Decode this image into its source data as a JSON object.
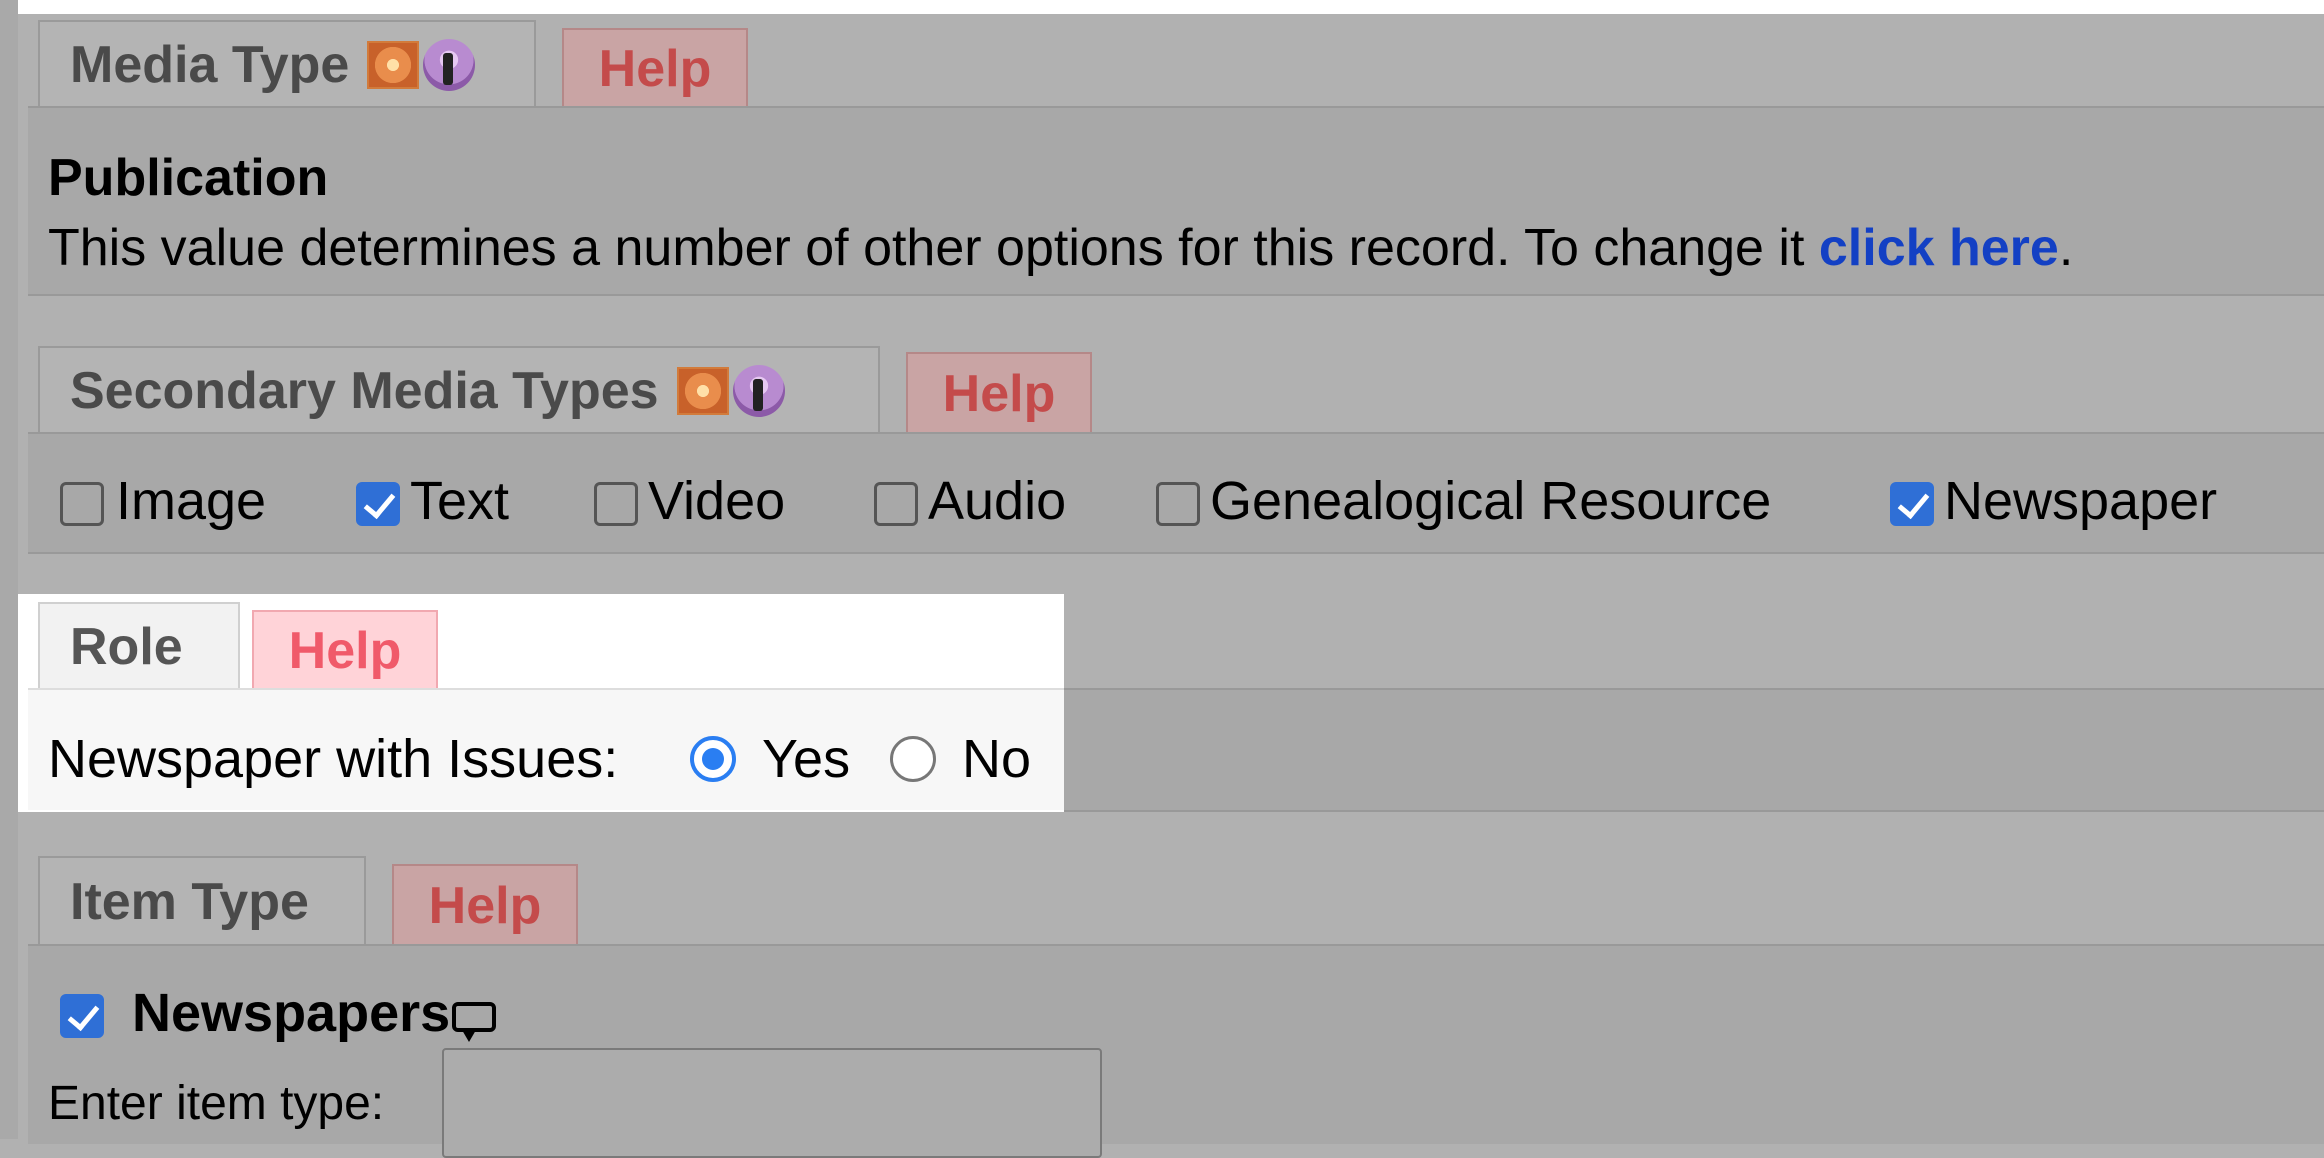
{
  "media_type": {
    "tab_label": "Media Type",
    "help_label": "Help",
    "value": "Publication",
    "description": "This value determines a number of other options for this record. To change it ",
    "link_text": "click here",
    "trailing": "."
  },
  "secondary_media_types": {
    "tab_label": "Secondary Media Types",
    "help_label": "Help",
    "options": [
      {
        "label": "Image",
        "checked": false
      },
      {
        "label": "Text",
        "checked": true
      },
      {
        "label": "Video",
        "checked": false
      },
      {
        "label": "Audio",
        "checked": false
      },
      {
        "label": "Genealogical Resource",
        "checked": false
      },
      {
        "label": "Newspaper",
        "checked": true
      }
    ]
  },
  "role": {
    "tab_label": "Role",
    "help_label": "Help",
    "question": "Newspaper with Issues:",
    "options": [
      {
        "label": "Yes",
        "selected": true
      },
      {
        "label": "No",
        "selected": false
      }
    ]
  },
  "item_type": {
    "tab_label": "Item Type",
    "help_label": "Help",
    "checkbox_label": "Newspapers",
    "checked": true,
    "input_label": "Enter item type:",
    "input_value": ""
  },
  "icons": [
    "media-type-icon",
    "podcast-icon",
    "comment-icon"
  ],
  "colors": {
    "help_text": "#c44b4b",
    "link": "#1340c4",
    "checkbox_checked": "#2f6fd6",
    "radio_selected": "#2a7ef2"
  }
}
